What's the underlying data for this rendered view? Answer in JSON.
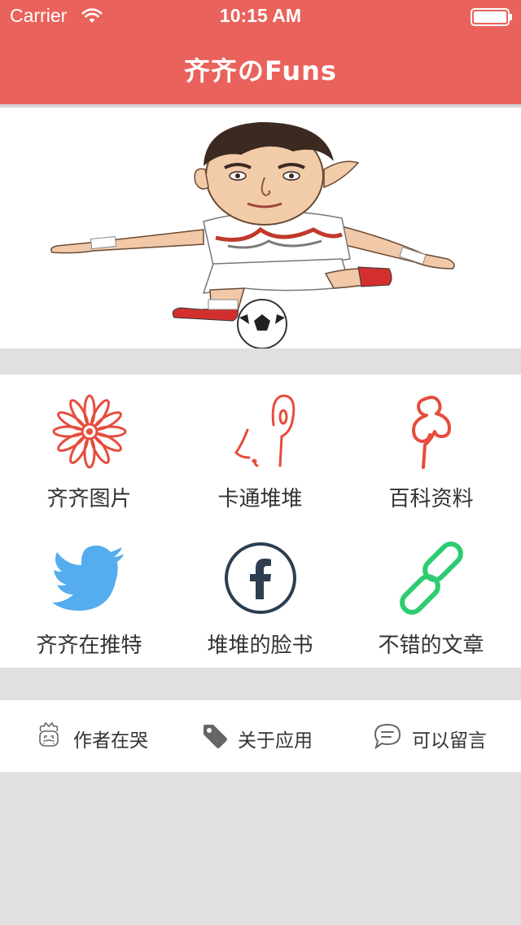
{
  "status_bar": {
    "carrier": "Carrier",
    "time": "10:15 AM"
  },
  "nav": {
    "title": "齐齐のFuns"
  },
  "colors": {
    "brand": "#e9625b",
    "twitter": "#55acee",
    "facebook": "#2c3e50",
    "link": "#2ecc71",
    "accent_red": "#e74c3c",
    "background": "#e0e0e0"
  },
  "hero": {
    "image": "cartoon-soccer-player"
  },
  "grid": {
    "items": [
      {
        "label": "齐齐图片",
        "icon": "flower-icon"
      },
      {
        "label": "卡通堆堆",
        "icon": "face-profile-icon"
      },
      {
        "label": "百科资料",
        "icon": "pushpin-icon"
      },
      {
        "label": "齐齐在推特",
        "icon": "twitter-icon"
      },
      {
        "label": "堆堆的脸书",
        "icon": "facebook-icon"
      },
      {
        "label": "不错的文章",
        "icon": "chain-link-icon"
      }
    ]
  },
  "footer": {
    "items": [
      {
        "label": "作者在哭",
        "icon": "crying-author-icon"
      },
      {
        "label": "关于应用",
        "icon": "tag-icon"
      },
      {
        "label": "可以留言",
        "icon": "speech-bubble-icon"
      }
    ]
  }
}
